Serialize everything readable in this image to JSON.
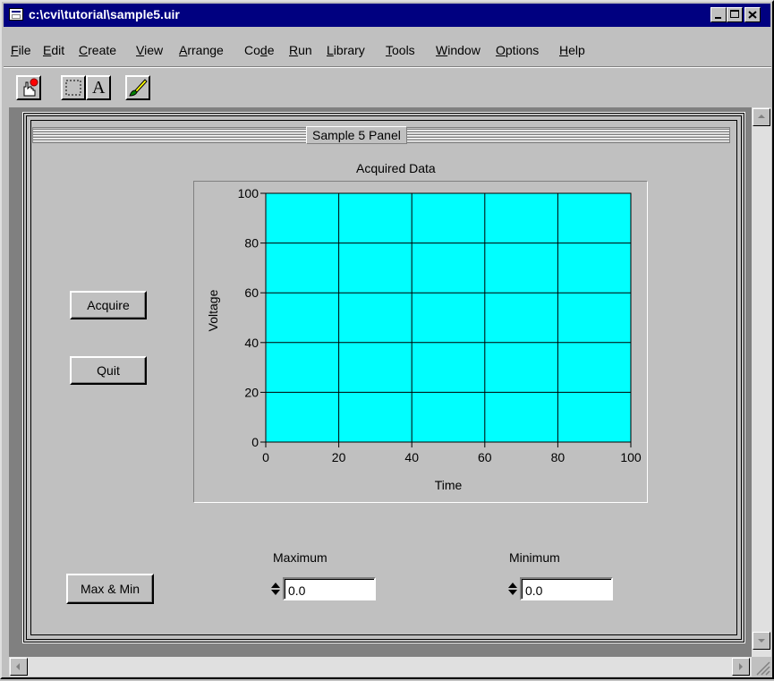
{
  "window": {
    "title": "c:\\cvi\\tutorial\\sample5.uir"
  },
  "menu": [
    {
      "label": "File",
      "key": "F",
      "rest": "ile"
    },
    {
      "label": "Edit",
      "key": "E",
      "rest": "dit"
    },
    {
      "label": "Create",
      "key": "C",
      "rest": "reate"
    },
    {
      "label": "View",
      "key": "V",
      "rest": "iew"
    },
    {
      "label": "Arrange",
      "key": "A",
      "rest": "rrange"
    },
    {
      "label": "Code",
      "pre": "Co",
      "key": "d",
      "rest": "e"
    },
    {
      "label": "Run",
      "key": "R",
      "rest": "un"
    },
    {
      "label": "Library",
      "key": "L",
      "rest": "ibrary"
    },
    {
      "label": "Tools",
      "key": "T",
      "rest": "ools"
    },
    {
      "label": "Window",
      "key": "W",
      "rest": "indow"
    },
    {
      "label": "Options",
      "key": "O",
      "rest": "ptions"
    },
    {
      "label": "Help",
      "key": "H",
      "rest": "elp"
    }
  ],
  "toolbar": {
    "text_tool_glyph": "A",
    "icons": [
      "operate-icon",
      "select-icon",
      "text-icon",
      "color-icon"
    ]
  },
  "panel": {
    "title": "Sample 5 Panel",
    "acquire_label": "Acquire",
    "quit_label": "Quit",
    "maxmin_label": "Max & Min",
    "maximum_label": "Maximum",
    "minimum_label": "Minimum",
    "maximum_value": "0.0",
    "minimum_value": "0.0"
  },
  "chart_data": {
    "type": "line",
    "title": "Acquired Data",
    "xlabel": "Time",
    "ylabel": "Voltage",
    "xlim": [
      0,
      100
    ],
    "ylim": [
      0,
      100
    ],
    "xticks": [
      0,
      20,
      40,
      60,
      80,
      100
    ],
    "yticks": [
      0,
      20,
      40,
      60,
      80,
      100
    ],
    "grid": true,
    "plot_background": "#00ffff",
    "series": []
  },
  "colors": {
    "titlebar": "#000080",
    "face": "#c0c0c0",
    "plot": "#00ffff"
  }
}
